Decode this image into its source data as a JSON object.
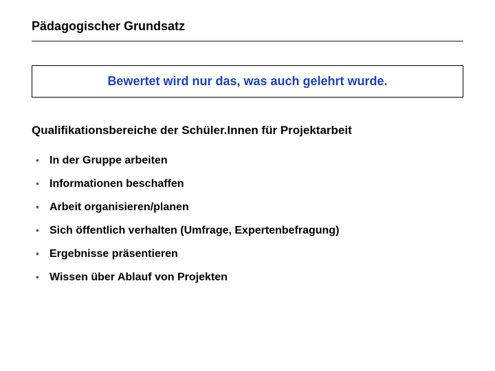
{
  "title": "Pädagogischer Grundsatz",
  "principle": "Bewertet wird nur das, was auch gelehrt wurde.",
  "subheading": "Qualifikationsbereiche der Schüler.Innen für Projektarbeit",
  "bullets": [
    "In der Gruppe arbeiten",
    "Informationen beschaffen",
    "Arbeit organisieren/planen",
    "Sich öffentlich verhalten (Umfrage, Expertenbefragung)",
    "Ergebnisse präsentieren",
    "Wissen über Ablauf von Projekten"
  ]
}
